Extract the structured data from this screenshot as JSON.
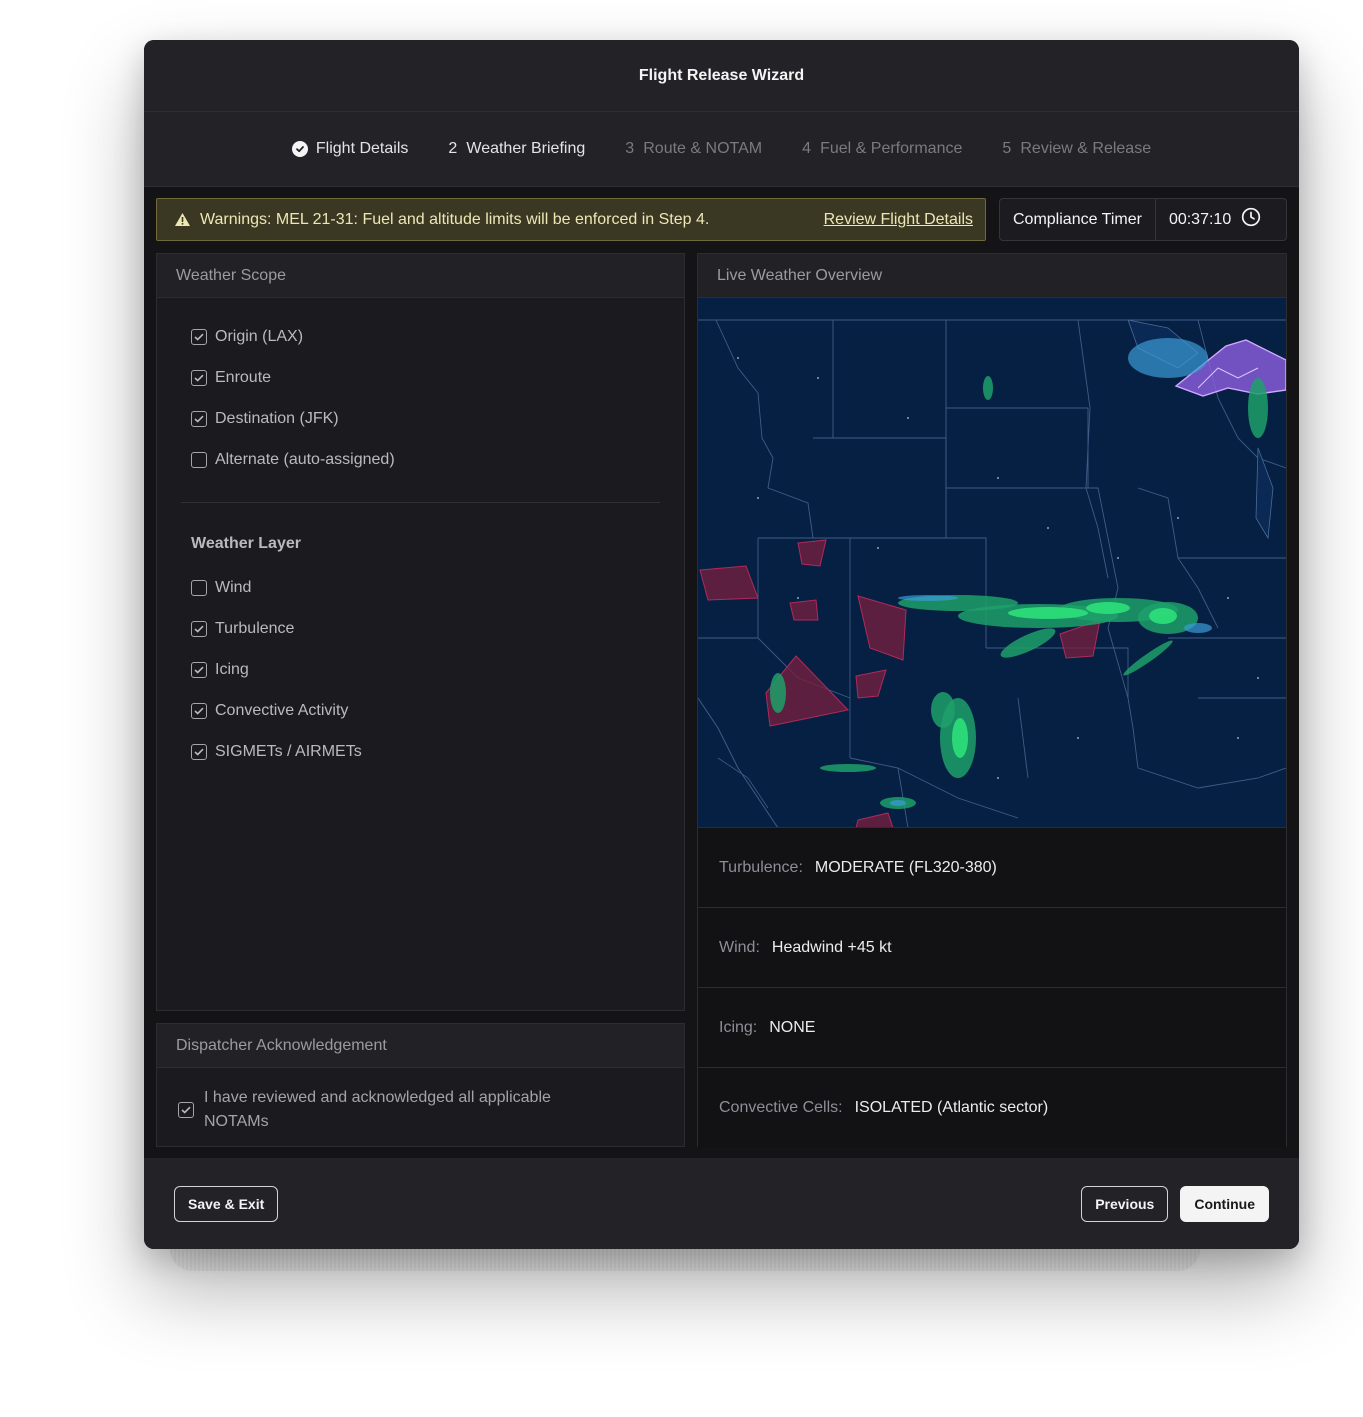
{
  "window": {
    "title": "Flight Release Wizard"
  },
  "steps": [
    {
      "number": "",
      "label": "Flight Details",
      "state": "done"
    },
    {
      "number": "2",
      "label": "Weather Briefing",
      "state": "current"
    },
    {
      "number": "3",
      "label": "Route & NOTAM",
      "state": "pending"
    },
    {
      "number": "4",
      "label": "Fuel & Performance",
      "state": "pending"
    },
    {
      "number": "5",
      "label": "Review & Release",
      "state": "pending"
    }
  ],
  "warning": {
    "text": "Warnings: MEL 21-31: Fuel and altitude limits will be enforced in Step 4.",
    "link": "Review Flight Details"
  },
  "timer": {
    "label": "Compliance Timer",
    "value": "00:37:10"
  },
  "scope": {
    "header": "Weather Scope",
    "items": [
      {
        "label": "Origin (LAX)",
        "checked": true
      },
      {
        "label": "Enroute",
        "checked": true
      },
      {
        "label": "Destination (JFK)",
        "checked": true
      },
      {
        "label": "Alternate (auto-assigned)",
        "checked": false
      }
    ],
    "layer_title": "Weather Layer",
    "layers": [
      {
        "label": "Wind",
        "checked": false
      },
      {
        "label": "Turbulence",
        "checked": true
      },
      {
        "label": "Icing",
        "checked": true
      },
      {
        "label": "Convective Activity",
        "checked": true
      },
      {
        "label": "SIGMETs / AIRMETs",
        "checked": true
      }
    ]
  },
  "ack": {
    "header": "Dispatcher Acknowledgement",
    "text": "I have reviewed and acknowledged all applicable NOTAMs",
    "checked": true
  },
  "overview": {
    "header": "Live Weather Overview",
    "rows": [
      {
        "label": "Turbulence:",
        "value": "MODERATE (FL320-380)"
      },
      {
        "label": "Wind:",
        "value": "Headwind +45 kt"
      },
      {
        "label": "Icing:",
        "value": "NONE"
      },
      {
        "label": "Convective Cells:",
        "value": "ISOLATED (Atlantic sector)"
      }
    ]
  },
  "footer": {
    "save_exit": "Save & Exit",
    "previous": "Previous",
    "continue": "Continue"
  },
  "colors": {
    "map_bg": "#062043",
    "precip_light": "#1fa06a",
    "precip_heavy": "#2ee07a",
    "sigmet": "#7a1f3d",
    "airmet_purple": "#b87cff",
    "warning_bg": "#3a3822"
  }
}
